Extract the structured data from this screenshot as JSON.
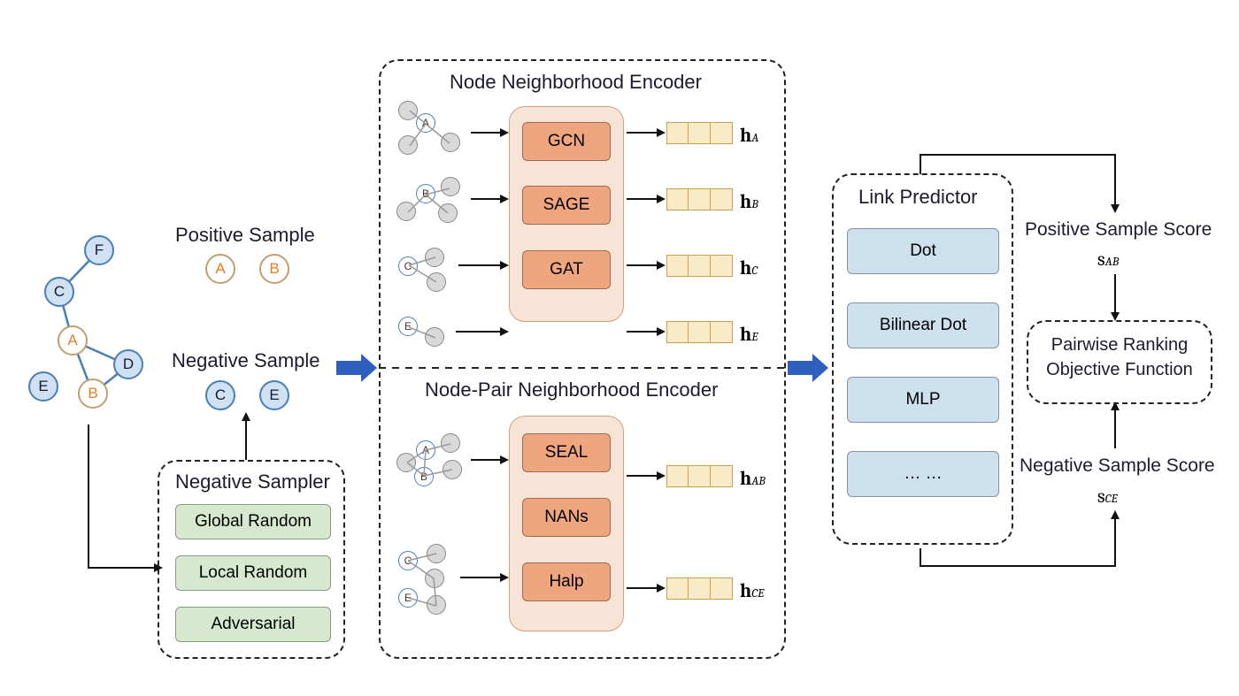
{
  "graph": {
    "nodes": [
      "A",
      "B",
      "C",
      "D",
      "E",
      "F"
    ],
    "highlighted": [
      "A",
      "B"
    ]
  },
  "samples": {
    "positive_title": "Positive Sample",
    "positive_nodes": [
      "A",
      "B"
    ],
    "negative_title": "Negative Sample",
    "negative_nodes": [
      "C",
      "E"
    ]
  },
  "negative_sampler": {
    "title": "Negative Sampler",
    "options": [
      "Global Random",
      "Local Random",
      "Adversarial"
    ]
  },
  "encoders": {
    "node_title": "Node Neighborhood Encoder",
    "node_methods": [
      "GCN",
      "SAGE",
      "GAT"
    ],
    "node_outputs": [
      "h_A",
      "h_B",
      "h_C",
      "h_E"
    ],
    "pair_title": "Node-Pair Neighborhood Encoder",
    "pair_methods": [
      "SEAL",
      "NANs",
      "Halp"
    ],
    "pair_outputs": [
      "h_AB",
      "h_CE"
    ]
  },
  "link_predictor": {
    "title": "Link Predictor",
    "methods": [
      "Dot",
      "Bilinear Dot",
      "MLP",
      "… …"
    ]
  },
  "objective": {
    "title": "Pairwise Ranking Objective Function",
    "pos_score_label": "Positive Sample Score",
    "pos_score_symbol": "s_AB",
    "neg_score_label": "Negative Sample Score",
    "neg_score_symbol": "s_CE"
  }
}
